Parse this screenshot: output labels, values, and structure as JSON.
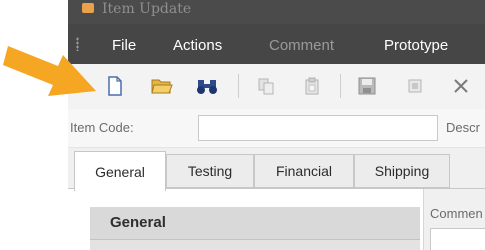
{
  "window": {
    "title": "Item Update"
  },
  "menubar": {
    "items": [
      {
        "label": "File",
        "enabled": true
      },
      {
        "label": "Actions",
        "enabled": true
      },
      {
        "label": "Comment",
        "enabled": false
      },
      {
        "label": "Prototype",
        "enabled": true
      }
    ]
  },
  "toolbar": {
    "icons": [
      "new-document-icon",
      "open-folder-icon",
      "find-binoculars-icon",
      "copy-icon",
      "paste-icon",
      "save-icon",
      "save-close-icon",
      "delete-x-icon"
    ]
  },
  "form": {
    "item_code_label": "Item Code:",
    "item_code_value": "",
    "description_label": "Descr"
  },
  "tabs": [
    "General",
    "Testing",
    "Financial",
    "Shipping"
  ],
  "active_tab": "General",
  "panel": {
    "group_title": "General",
    "comments_label": "Commen"
  },
  "colors": {
    "arrow": "#f5a623",
    "titlebar": "#4b4b4b",
    "menubar": "#464646"
  }
}
